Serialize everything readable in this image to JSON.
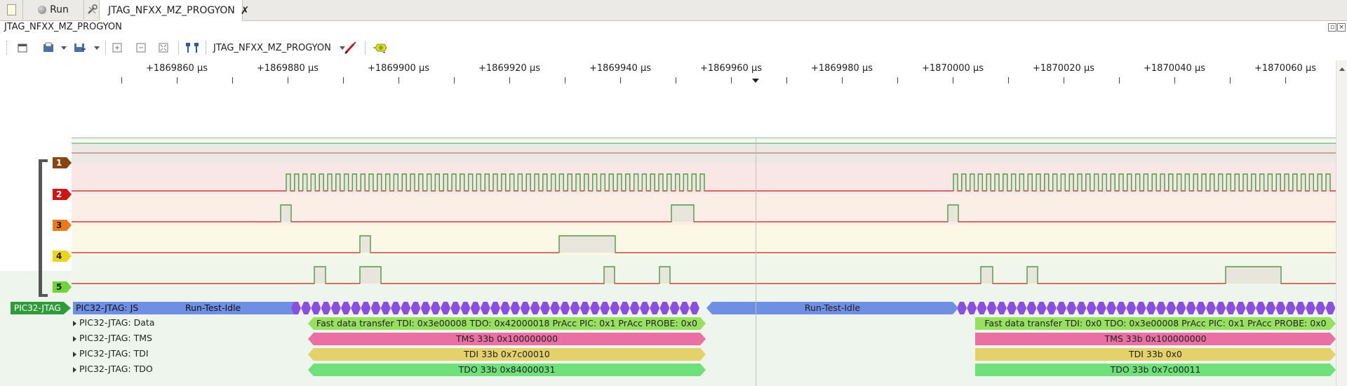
{
  "tabs": [
    {
      "label": ""
    },
    {
      "label": "Run"
    },
    {
      "label": ""
    },
    {
      "label": "JTAG_NFXX_MZ_PROGYON"
    }
  ],
  "window_title": "JTAG_NFXX_MZ_PROGYON",
  "toolbar": {
    "session_name": "JTAG_NFXX_MZ_PROGYON"
  },
  "ruler": {
    "labels": [
      "+1869860 µs",
      "+1869880 µs",
      "+1869900 µs",
      "+1869920 µs",
      "+1869940 µs",
      "+1869960 µs",
      "+1869980 µs",
      "+1870000 µs",
      "+1870020 µs",
      "+1870040 µs",
      "+1870060 µs"
    ]
  },
  "channels": [
    {
      "number": "1",
      "color": "#8b4513"
    },
    {
      "number": "2",
      "color": "#d01515"
    },
    {
      "number": "3",
      "color": "#ec7a1a"
    },
    {
      "number": "4",
      "color": "#ecd418"
    },
    {
      "number": "5",
      "color": "#6dd53a"
    }
  ],
  "decoder": {
    "tag": "PIC32-JTAG",
    "js_label": "PIC32-JTAG: JS",
    "rows": [
      {
        "label": "PIC32-JTAG: Data"
      },
      {
        "label": "PIC32-JTAG: TMS"
      },
      {
        "label": "PIC32-JTAG: TDI"
      },
      {
        "label": "PIC32-JTAG: TDO"
      }
    ],
    "states": [
      "Run-Test-Idle",
      "Run-Test-Idle"
    ],
    "data_annotations": [
      "Fast data transfer TDI: 0x3e00008 TDO: 0x42000018 PrAcc PIC: 0x1 PrAcc PROBE: 0x0",
      "Fast data transfer TDI: 0x0 TDO: 0x3e00008 PrAcc PIC: 0x1 PrAcc PROBE: 0x0"
    ],
    "tms_annotations": [
      "TMS 33b 0x100000000",
      "TMS 33b 0x100000000"
    ],
    "tdi_annotations": [
      "TDI 33b 0x7c00010",
      "TDI 33b 0x0"
    ],
    "tdo_annotations": [
      "TDO 33b 0x84000031",
      "TDO 33b 0x7c00011"
    ]
  }
}
